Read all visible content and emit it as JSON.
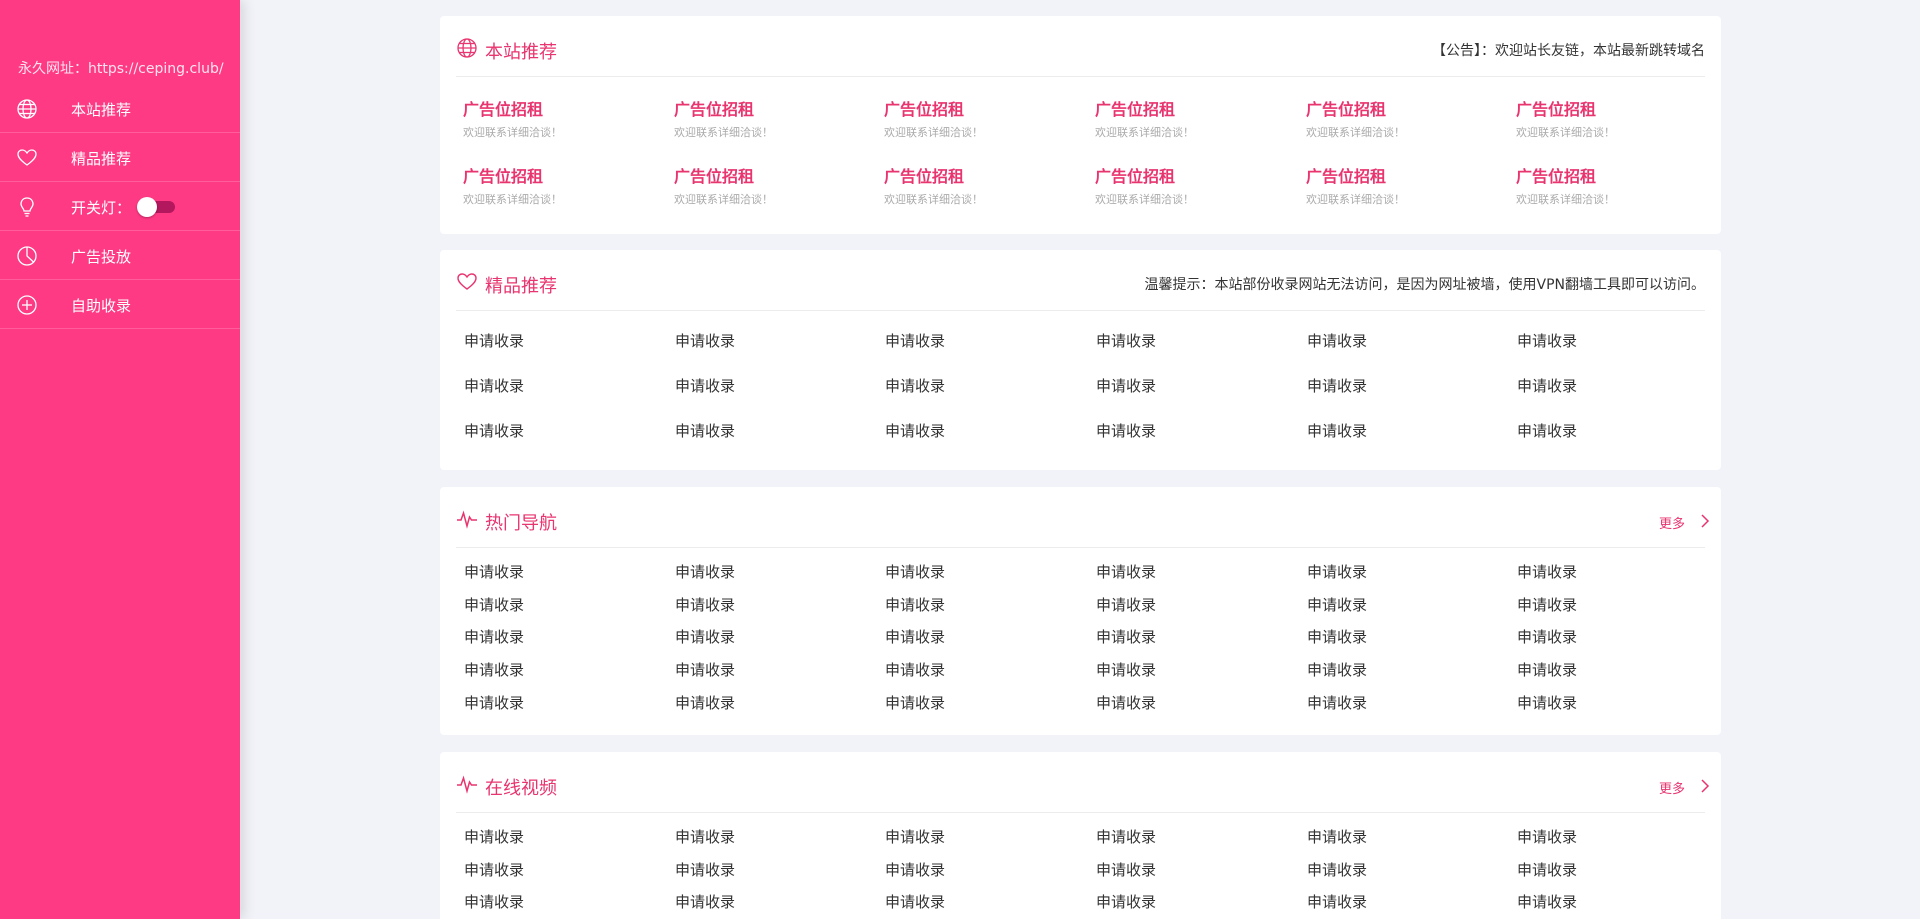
{
  "sidebar": {
    "permanent_url": "永久网址：https://ceping.club/",
    "items": [
      {
        "label": "本站推荐",
        "icon": "globe-icon"
      },
      {
        "label": "精品推荐",
        "icon": "heart-icon"
      },
      {
        "label": "开关灯：",
        "icon": "lightbulb-icon"
      },
      {
        "label": "广告投放",
        "icon": "pie-chart-icon"
      },
      {
        "label": "自助收录",
        "icon": "plus-circle-icon"
      }
    ]
  },
  "sections": {
    "recommend": {
      "title": "本站推荐",
      "notice": "【公告】：欢迎站长友链，本站最新跳转域名",
      "ads": [
        {
          "title": "广告位招租",
          "sub": "欢迎联系详细洽谈！"
        },
        {
          "title": "广告位招租",
          "sub": "欢迎联系详细洽谈！"
        },
        {
          "title": "广告位招租",
          "sub": "欢迎联系详细洽谈！"
        },
        {
          "title": "广告位招租",
          "sub": "欢迎联系详细洽谈！"
        },
        {
          "title": "广告位招租",
          "sub": "欢迎联系详细洽谈！"
        },
        {
          "title": "广告位招租",
          "sub": "欢迎联系详细洽谈！"
        },
        {
          "title": "广告位招租",
          "sub": "欢迎联系详细洽谈！"
        },
        {
          "title": "广告位招租",
          "sub": "欢迎联系详细洽谈！"
        },
        {
          "title": "广告位招租",
          "sub": "欢迎联系详细洽谈！"
        },
        {
          "title": "广告位招租",
          "sub": "欢迎联系详细洽谈！"
        },
        {
          "title": "广告位招租",
          "sub": "欢迎联系详细洽谈！"
        },
        {
          "title": "广告位招租",
          "sub": "欢迎联系详细洽谈！"
        }
      ]
    },
    "boutique": {
      "title": "精品推荐",
      "notice": "温馨提示：本站部份收录网站无法访问，是因为网址被墙，使用VPN翻墙工具即可以访问。",
      "links": [
        "申请收录",
        "申请收录",
        "申请收录",
        "申请收录",
        "申请收录",
        "申请收录",
        "申请收录",
        "申请收录",
        "申请收录",
        "申请收录",
        "申请收录",
        "申请收录",
        "申请收录",
        "申请收录",
        "申请收录",
        "申请收录",
        "申请收录",
        "申请收录"
      ]
    },
    "hot": {
      "title": "热门导航",
      "more": "更多",
      "links": [
        "申请收录",
        "申请收录",
        "申请收录",
        "申请收录",
        "申请收录",
        "申请收录",
        "申请收录",
        "申请收录",
        "申请收录",
        "申请收录",
        "申请收录",
        "申请收录",
        "申请收录",
        "申请收录",
        "申请收录",
        "申请收录",
        "申请收录",
        "申请收录",
        "申请收录",
        "申请收录",
        "申请收录",
        "申请收录",
        "申请收录",
        "申请收录",
        "申请收录",
        "申请收录",
        "申请收录",
        "申请收录",
        "申请收录",
        "申请收录"
      ]
    },
    "video": {
      "title": "在线视频",
      "more": "更多",
      "links": [
        "申请收录",
        "申请收录",
        "申请收录",
        "申请收录",
        "申请收录",
        "申请收录",
        "申请收录",
        "申请收录",
        "申请收录",
        "申请收录",
        "申请收录",
        "申请收录",
        "申请收录",
        "申请收录",
        "申请收录",
        "申请收录",
        "申请收录",
        "申请收录"
      ]
    }
  },
  "colors": {
    "accent": "#ff3a85",
    "title_pink": "#e8346f",
    "background": "#f2f2f9"
  }
}
